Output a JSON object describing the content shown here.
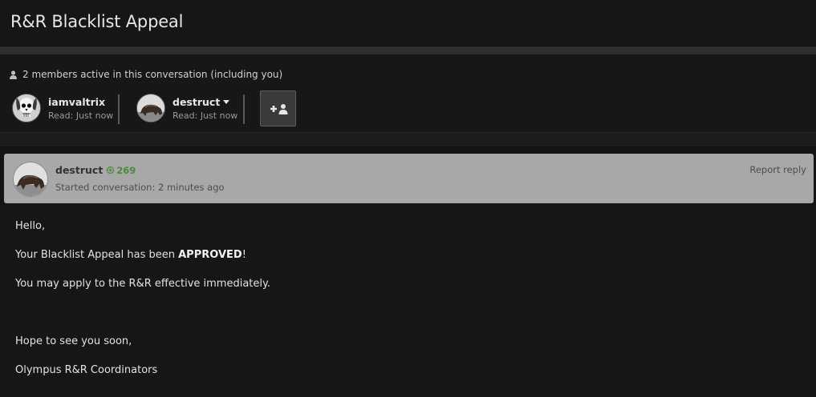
{
  "header": {
    "title": "R&R Blacklist Appeal"
  },
  "participants": {
    "active_text": "2 members active in this conversation (including you)",
    "members": [
      {
        "name": "iamvaltrix",
        "status": "Read: Just now",
        "avatar": "skull-avatar"
      },
      {
        "name": "destruct",
        "status": "Read: Just now",
        "avatar": "bear-avatar",
        "has_menu": true
      }
    ],
    "invite_icon": "add-user-icon"
  },
  "message": {
    "author": "destruct",
    "reputation": "269",
    "meta": "Started conversation: 2 minutes ago",
    "report_label": "Report reply",
    "body": {
      "greeting": "Hello,",
      "approved_prefix": "Your Blacklist Appeal has been ",
      "approved_word": "APPROVED",
      "approved_suffix": "!",
      "line3": "You may apply to the R&R effective immediately.",
      "closing": "Hope to see you soon,",
      "signature": "Olympus R&R Coordinators"
    }
  },
  "colors": {
    "background": "#141414",
    "message_header": "#a8a8a8",
    "reputation": "#4e8a3a"
  }
}
